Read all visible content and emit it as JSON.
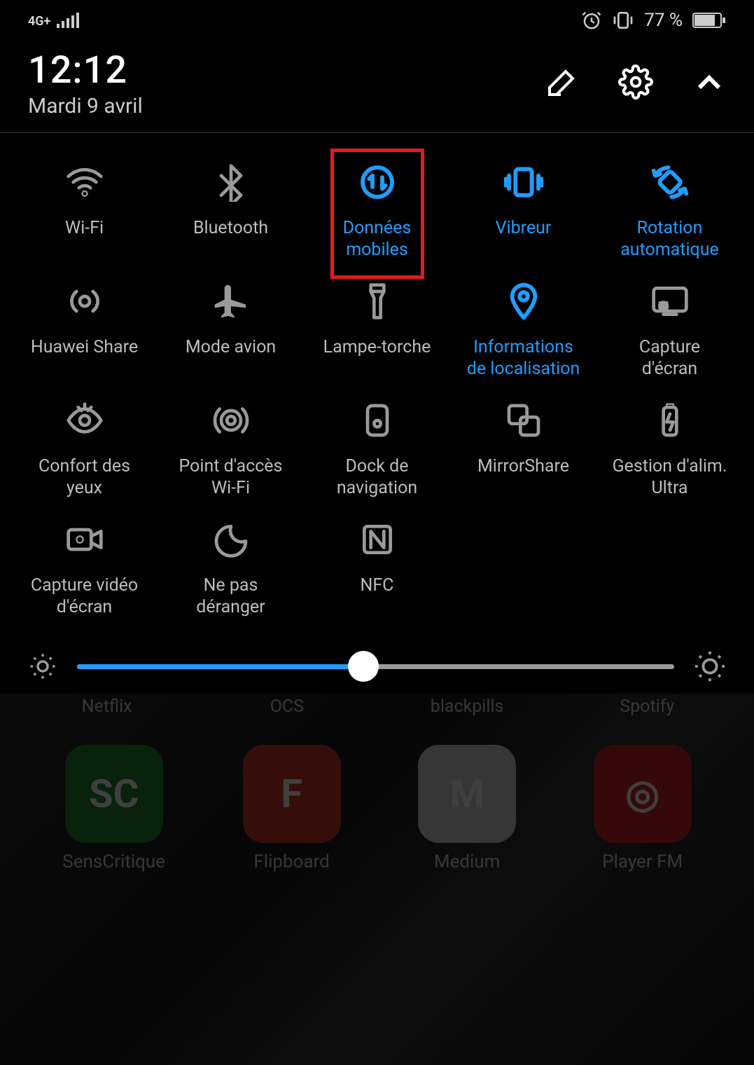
{
  "status": {
    "network": "4G+",
    "battery_percent": "77 %"
  },
  "header": {
    "time": "12:12",
    "date": "Mardi 9 avril"
  },
  "tiles": [
    {
      "id": "wifi",
      "label": "Wi-Fi",
      "active": false,
      "highlight": false,
      "icon": "wifi-icon"
    },
    {
      "id": "bluetooth",
      "label": "Bluetooth",
      "active": false,
      "highlight": false,
      "icon": "bluetooth-icon"
    },
    {
      "id": "mobile-data",
      "label": "Données\nmobiles",
      "active": true,
      "highlight": true,
      "icon": "mobile-data-icon"
    },
    {
      "id": "vibrate",
      "label": "Vibreur",
      "active": true,
      "highlight": false,
      "icon": "vibrate-icon"
    },
    {
      "id": "auto-rotate",
      "label": "Rotation\nautomatique",
      "active": true,
      "highlight": false,
      "icon": "rotate-icon"
    },
    {
      "id": "huawei-share",
      "label": "Huawei Share",
      "active": false,
      "highlight": false,
      "icon": "share-icon"
    },
    {
      "id": "airplane",
      "label": "Mode avion",
      "active": false,
      "highlight": false,
      "icon": "airplane-icon"
    },
    {
      "id": "flashlight",
      "label": "Lampe-torche",
      "active": false,
      "highlight": false,
      "icon": "flashlight-icon"
    },
    {
      "id": "location",
      "label": "Informations\nde localisation",
      "active": true,
      "highlight": false,
      "icon": "location-icon"
    },
    {
      "id": "screenshot",
      "label": "Capture\nd'écran",
      "active": false,
      "highlight": false,
      "icon": "screenshot-icon"
    },
    {
      "id": "eye-comfort",
      "label": "Confort des\nyeux",
      "active": false,
      "highlight": false,
      "icon": "eye-icon"
    },
    {
      "id": "hotspot",
      "label": "Point d'accès\nWi-Fi",
      "active": false,
      "highlight": false,
      "icon": "hotspot-icon"
    },
    {
      "id": "nav-dock",
      "label": "Dock de\nnavigation",
      "active": false,
      "highlight": false,
      "icon": "navdock-icon"
    },
    {
      "id": "mirror-share",
      "label": "MirrorShare",
      "active": false,
      "highlight": false,
      "icon": "mirror-icon"
    },
    {
      "id": "power-mgmt",
      "label": "Gestion d'alim.\nUltra",
      "active": false,
      "highlight": false,
      "icon": "battery-ultra-icon"
    },
    {
      "id": "screen-record",
      "label": "Capture vidéo\nd'écran",
      "active": false,
      "highlight": false,
      "icon": "screenrec-icon"
    },
    {
      "id": "dnd",
      "label": "Ne pas\ndéranger",
      "active": false,
      "highlight": false,
      "icon": "dnd-icon"
    },
    {
      "id": "nfc",
      "label": "NFC",
      "active": false,
      "highlight": false,
      "icon": "nfc-icon"
    }
  ],
  "brightness": {
    "value_percent": 48
  },
  "home": {
    "row1": [
      "Netflix",
      "OCS",
      "blackpills",
      "Spotify"
    ],
    "row2": [
      {
        "label": "SensCritique",
        "bg": "#1f8b2e",
        "text": "SC"
      },
      {
        "label": "Flipboard",
        "bg": "#d83a2e",
        "text": "F"
      },
      {
        "label": "Medium",
        "bg": "#d9d9d9",
        "text": "M"
      },
      {
        "label": "Player FM",
        "bg": "#d7262c",
        "text": "◎"
      }
    ]
  },
  "colors": {
    "accent": "#1f9dff",
    "inactive": "#9a9a9a"
  }
}
